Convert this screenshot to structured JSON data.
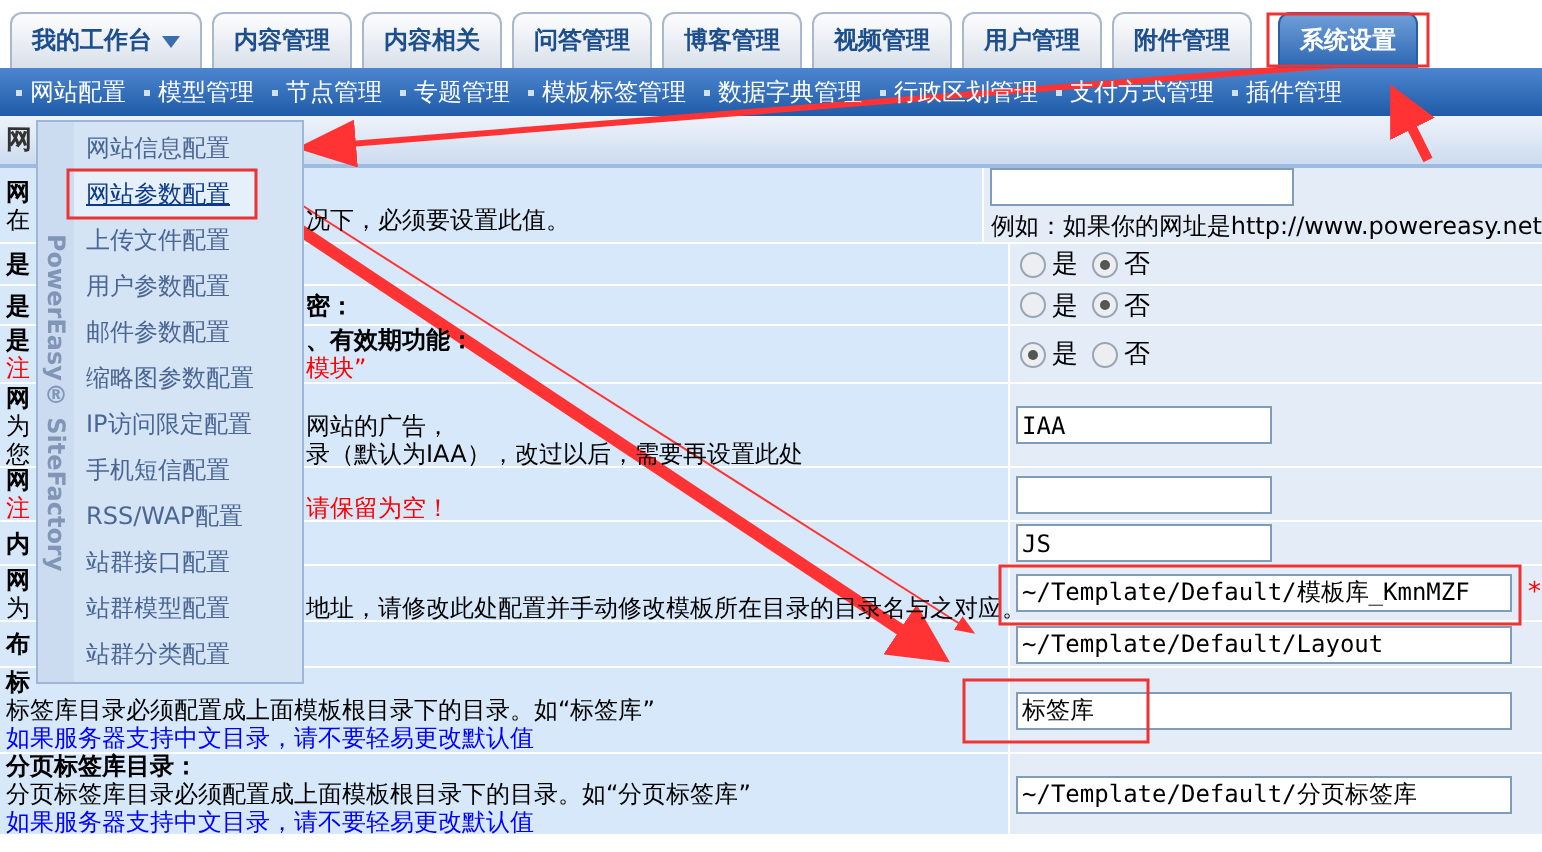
{
  "tabs": [
    {
      "label": "我的工作台",
      "dropdown": true,
      "selected": false
    },
    {
      "label": "内容管理",
      "selected": false
    },
    {
      "label": "内容相关",
      "selected": false
    },
    {
      "label": "问答管理",
      "selected": false
    },
    {
      "label": "博客管理",
      "selected": false
    },
    {
      "label": "视频管理",
      "selected": false
    },
    {
      "label": "用户管理",
      "selected": false
    },
    {
      "label": "附件管理",
      "selected": false
    },
    {
      "label": "系统设置",
      "selected": true
    }
  ],
  "subnav": [
    "网站配置",
    "模型管理",
    "节点管理",
    "专题管理",
    "模板标签管理",
    "数据字典管理",
    "行政区划管理",
    "支付方式管理",
    "插件管理"
  ],
  "page_title": "网",
  "rows": [
    {
      "lines": [
        {
          "kind": "title",
          "left": "网"
        },
        {
          "kind": "text",
          "left": "在",
          "right": "况下，必须要设置此值。"
        }
      ],
      "control": {
        "kind": "input",
        "note": "例如：如果你的网址是http://www.powereasy.net"
      }
    },
    {
      "lines": [
        {
          "kind": "title",
          "left": "是"
        }
      ],
      "control": {
        "kind": "radio",
        "options": [
          {
            "label": "是",
            "selected": false
          },
          {
            "label": "否",
            "selected": true
          }
        ]
      }
    },
    {
      "lines": [
        {
          "kind": "title",
          "left": "是",
          "right": "密："
        }
      ],
      "control": {
        "kind": "radio",
        "options": [
          {
            "label": "是",
            "selected": false
          },
          {
            "label": "否",
            "selected": true
          }
        ]
      }
    },
    {
      "lines": [
        {
          "kind": "title",
          "left": "是",
          "right": "、有效期功能："
        },
        {
          "kind": "warning",
          "left": "注",
          "right": "模块”"
        }
      ],
      "control": {
        "kind": "radio",
        "options": [
          {
            "label": "是",
            "selected": true
          },
          {
            "label": "否",
            "selected": false
          }
        ]
      }
    },
    {
      "lines": [
        {
          "kind": "title",
          "left": "网"
        },
        {
          "kind": "text",
          "left": "为",
          "right": "网站的广告，"
        },
        {
          "kind": "text",
          "left": "您",
          "right": "录（默认为IAA），改过以后，需要再设置此处"
        }
      ],
      "control": {
        "kind": "input",
        "value": "IAA"
      }
    },
    {
      "lines": [
        {
          "kind": "title",
          "left": "网"
        },
        {
          "kind": "warning",
          "left": "注",
          "right": "请保留为空！"
        }
      ],
      "control": {
        "kind": "input"
      }
    },
    {
      "lines": [
        {
          "kind": "title",
          "left": "内"
        }
      ],
      "control": {
        "kind": "input",
        "value": "JS"
      }
    },
    {
      "lines": [
        {
          "kind": "title",
          "left": "网"
        },
        {
          "kind": "text",
          "left": "为",
          "right": "地址，请修改此处配置并手动修改模板所在目录的目录名与之对应。"
        }
      ],
      "control": {
        "kind": "input",
        "value": "~/Template/Default/模板库_KmnMZF",
        "required": "*"
      }
    },
    {
      "lines": [
        {
          "kind": "title",
          "left": "布"
        }
      ],
      "control": {
        "kind": "input",
        "value": "~/Template/Default/Layout"
      }
    },
    {
      "lines": [
        {
          "kind": "title",
          "left": "标"
        },
        {
          "kind": "text",
          "left": "标签库目录必须配置成上面模板根目录下的目录。如“标签库”"
        },
        {
          "kind": "link",
          "left": "如果服务器支持中文目录，请不要轻易更改默认值"
        }
      ],
      "control": {
        "kind": "input",
        "value": "标签库"
      }
    },
    {
      "lines": [
        {
          "kind": "title",
          "left": "分页标签库目录："
        },
        {
          "kind": "text",
          "left": "分页标签库目录必须配置成上面模板根目录下的目录。如“分页标签库”"
        },
        {
          "kind": "link",
          "left": "如果服务器支持中文目录，请不要轻易更改默认值"
        }
      ],
      "control": {
        "kind": "input",
        "value": "~/Template/Default/分页标签库"
      }
    }
  ],
  "menu": {
    "brand": "PowerEasy® SiteFactory",
    "items": [
      {
        "label": "网站信息配置",
        "selected": false
      },
      {
        "label": "网站参数配置",
        "selected": true
      },
      {
        "label": "上传文件配置",
        "selected": false
      },
      {
        "label": "用户参数配置",
        "selected": false
      },
      {
        "label": "邮件参数配置",
        "selected": false
      },
      {
        "label": "缩略图参数配置",
        "selected": false
      },
      {
        "label": "IP访问限定配置",
        "selected": false
      },
      {
        "label": "手机短信配置",
        "selected": false
      },
      {
        "label": "RSS/WAP配置",
        "selected": false
      },
      {
        "label": "站群接口配置",
        "selected": false
      },
      {
        "label": "站群模型配置",
        "selected": false
      },
      {
        "label": "站群分类配置",
        "selected": false
      }
    ]
  }
}
